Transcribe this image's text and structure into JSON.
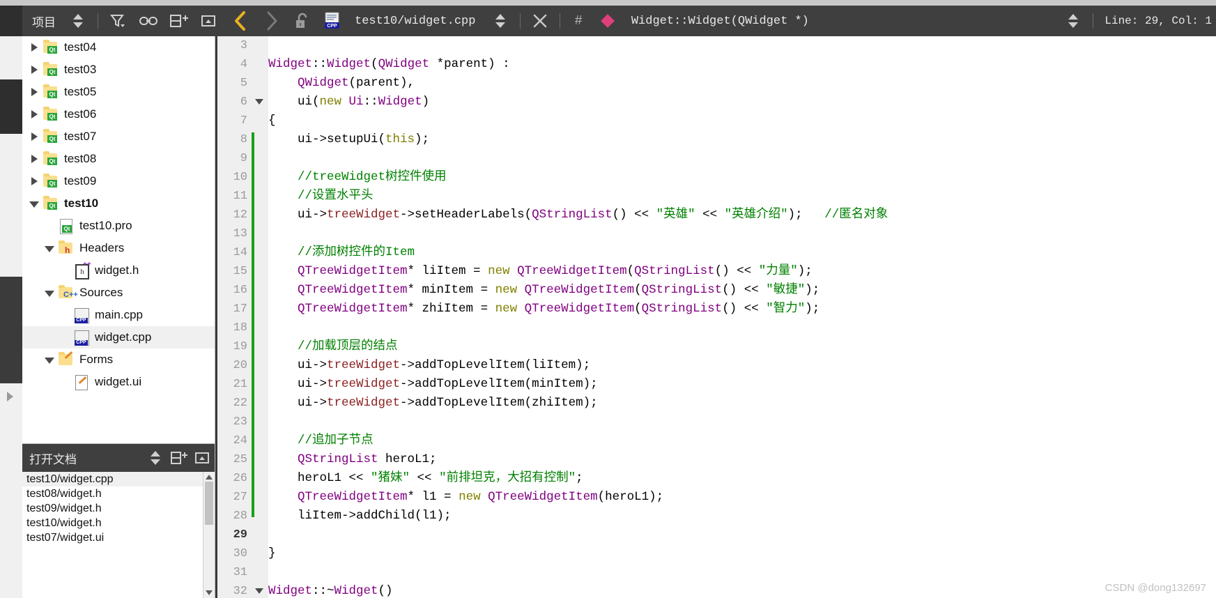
{
  "toolbar": {
    "project_label": "项目",
    "filter_icon": "filter-icon",
    "link_icon": "link-icon",
    "split_icon": "split-horizontal-icon",
    "close_split_icon": "close-split-icon",
    "back_icon": "navigate-back-icon",
    "forward_icon": "navigate-forward-icon",
    "lock_icon": "unlocked-padlock-icon",
    "file_icon": "cpp-file-icon",
    "file_path": "test10/widget.cpp",
    "updown_icon": "updown-arrows-icon",
    "close_icon": "close-x-icon",
    "hash_symbol": "#",
    "symbol_marker_icon": "diamond-marker-icon",
    "symbol_name": "Widget::Widget(QWidget *)",
    "line_col": "Line: 29, Col: 1"
  },
  "sidebar": {
    "tree_items": [
      {
        "label": "test04",
        "indent": 0,
        "twisty": "closed",
        "icon": "qt-folder-icon",
        "bold": false,
        "selected": false
      },
      {
        "label": "test03",
        "indent": 0,
        "twisty": "closed",
        "icon": "qt-folder-icon",
        "bold": false,
        "selected": false
      },
      {
        "label": "test05",
        "indent": 0,
        "twisty": "closed",
        "icon": "qt-folder-icon",
        "bold": false,
        "selected": false
      },
      {
        "label": "test06",
        "indent": 0,
        "twisty": "closed",
        "icon": "qt-folder-icon",
        "bold": false,
        "selected": false
      },
      {
        "label": "test07",
        "indent": 0,
        "twisty": "closed",
        "icon": "qt-folder-icon",
        "bold": false,
        "selected": false
      },
      {
        "label": "test08",
        "indent": 0,
        "twisty": "closed",
        "icon": "qt-folder-icon",
        "bold": false,
        "selected": false
      },
      {
        "label": "test09",
        "indent": 0,
        "twisty": "closed",
        "icon": "qt-folder-icon",
        "bold": false,
        "selected": false
      },
      {
        "label": "test10",
        "indent": 0,
        "twisty": "open",
        "icon": "qt-folder-icon",
        "bold": true,
        "selected": false
      },
      {
        "label": "test10.pro",
        "indent": 1,
        "twisty": "none",
        "icon": "qt-pro-file-icon",
        "bold": false,
        "selected": false
      },
      {
        "label": "Headers",
        "indent": 1,
        "twisty": "open",
        "icon": "h-folder-icon",
        "bold": false,
        "selected": false
      },
      {
        "label": "widget.h",
        "indent": 2,
        "twisty": "none",
        "icon": "hpp-file-icon",
        "bold": false,
        "selected": false
      },
      {
        "label": "Sources",
        "indent": 1,
        "twisty": "open",
        "icon": "cpp-folder-icon",
        "bold": false,
        "selected": false
      },
      {
        "label": "main.cpp",
        "indent": 2,
        "twisty": "none",
        "icon": "cpp-file-icon",
        "bold": false,
        "selected": false
      },
      {
        "label": "widget.cpp",
        "indent": 2,
        "twisty": "none",
        "icon": "cpp-file-icon",
        "bold": false,
        "selected": true
      },
      {
        "label": "Forms",
        "indent": 1,
        "twisty": "open",
        "icon": "forms-folder-icon",
        "bold": false,
        "selected": false
      },
      {
        "label": "widget.ui",
        "indent": 2,
        "twisty": "none",
        "icon": "ui-file-icon",
        "bold": false,
        "selected": false
      }
    ],
    "opendocs": {
      "title": "打开文档",
      "updown_icon": "updown-arrows-icon",
      "split_icon": "split-horizontal-icon",
      "close_icon": "close-split-icon",
      "files": [
        {
          "name": "test10/widget.cpp",
          "selected": true
        },
        {
          "name": "test08/widget.h",
          "selected": false
        },
        {
          "name": "test09/widget.h",
          "selected": false
        },
        {
          "name": "test10/widget.h",
          "selected": false
        },
        {
          "name": "test07/widget.ui",
          "selected": false
        }
      ]
    }
  },
  "editor": {
    "current_line": 29,
    "fold_lines": [
      6,
      32
    ],
    "lines": [
      {
        "n": 3,
        "tokens": []
      },
      {
        "n": 4,
        "tokens": [
          {
            "t": "Widget",
            "c": "c-type"
          },
          {
            "t": "::",
            "c": "c-plain"
          },
          {
            "t": "Widget",
            "c": "c-type"
          },
          {
            "t": "(",
            "c": "c-plain"
          },
          {
            "t": "QWidget",
            "c": "c-type"
          },
          {
            "t": " *parent) :",
            "c": "c-plain"
          }
        ]
      },
      {
        "n": 5,
        "tokens": [
          {
            "t": "    ",
            "c": "c-plain"
          },
          {
            "t": "QWidget",
            "c": "c-type"
          },
          {
            "t": "(parent),",
            "c": "c-plain"
          }
        ]
      },
      {
        "n": 6,
        "tokens": [
          {
            "t": "    ui(",
            "c": "c-plain"
          },
          {
            "t": "new",
            "c": "c-kw"
          },
          {
            "t": " ",
            "c": "c-plain"
          },
          {
            "t": "Ui",
            "c": "c-type"
          },
          {
            "t": "::",
            "c": "c-plain"
          },
          {
            "t": "Widget",
            "c": "c-type"
          },
          {
            "t": ")",
            "c": "c-plain"
          }
        ]
      },
      {
        "n": 7,
        "tokens": [
          {
            "t": "{",
            "c": "c-plain"
          }
        ]
      },
      {
        "n": 8,
        "tokens": [
          {
            "t": "    ui->setupUi(",
            "c": "c-plain"
          },
          {
            "t": "this",
            "c": "c-kw"
          },
          {
            "t": ");",
            "c": "c-plain"
          }
        ]
      },
      {
        "n": 9,
        "tokens": []
      },
      {
        "n": 10,
        "tokens": [
          {
            "t": "    //treeWidget树控件使用",
            "c": "c-comment"
          }
        ]
      },
      {
        "n": 11,
        "tokens": [
          {
            "t": "    //设置水平头",
            "c": "c-comment"
          }
        ]
      },
      {
        "n": 12,
        "tokens": [
          {
            "t": "    ui->",
            "c": "c-plain"
          },
          {
            "t": "treeWidget",
            "c": "c-member"
          },
          {
            "t": "->setHeaderLabels(",
            "c": "c-plain"
          },
          {
            "t": "QStringList",
            "c": "c-type"
          },
          {
            "t": "() << ",
            "c": "c-plain"
          },
          {
            "t": "\"英雄\"",
            "c": "c-str"
          },
          {
            "t": " << ",
            "c": "c-plain"
          },
          {
            "t": "\"英雄介绍\"",
            "c": "c-str"
          },
          {
            "t": ");   ",
            "c": "c-plain"
          },
          {
            "t": "//匿名对象",
            "c": "c-comment"
          }
        ]
      },
      {
        "n": 13,
        "tokens": []
      },
      {
        "n": 14,
        "tokens": [
          {
            "t": "    //添加树控件的Item",
            "c": "c-comment"
          }
        ]
      },
      {
        "n": 15,
        "tokens": [
          {
            "t": "    ",
            "c": "c-plain"
          },
          {
            "t": "QTreeWidgetItem",
            "c": "c-type"
          },
          {
            "t": "* liItem = ",
            "c": "c-plain"
          },
          {
            "t": "new",
            "c": "c-kw"
          },
          {
            "t": " ",
            "c": "c-plain"
          },
          {
            "t": "QTreeWidgetItem",
            "c": "c-type"
          },
          {
            "t": "(",
            "c": "c-plain"
          },
          {
            "t": "QStringList",
            "c": "c-type"
          },
          {
            "t": "() << ",
            "c": "c-plain"
          },
          {
            "t": "\"力量\"",
            "c": "c-str"
          },
          {
            "t": ");",
            "c": "c-plain"
          }
        ]
      },
      {
        "n": 16,
        "tokens": [
          {
            "t": "    ",
            "c": "c-plain"
          },
          {
            "t": "QTreeWidgetItem",
            "c": "c-type"
          },
          {
            "t": "* minItem = ",
            "c": "c-plain"
          },
          {
            "t": "new",
            "c": "c-kw"
          },
          {
            "t": " ",
            "c": "c-plain"
          },
          {
            "t": "QTreeWidgetItem",
            "c": "c-type"
          },
          {
            "t": "(",
            "c": "c-plain"
          },
          {
            "t": "QStringList",
            "c": "c-type"
          },
          {
            "t": "() << ",
            "c": "c-plain"
          },
          {
            "t": "\"敏捷\"",
            "c": "c-str"
          },
          {
            "t": ");",
            "c": "c-plain"
          }
        ]
      },
      {
        "n": 17,
        "tokens": [
          {
            "t": "    ",
            "c": "c-plain"
          },
          {
            "t": "QTreeWidgetItem",
            "c": "c-type"
          },
          {
            "t": "* zhiItem = ",
            "c": "c-plain"
          },
          {
            "t": "new",
            "c": "c-kw"
          },
          {
            "t": " ",
            "c": "c-plain"
          },
          {
            "t": "QTreeWidgetItem",
            "c": "c-type"
          },
          {
            "t": "(",
            "c": "c-plain"
          },
          {
            "t": "QStringList",
            "c": "c-type"
          },
          {
            "t": "() << ",
            "c": "c-plain"
          },
          {
            "t": "\"智力\"",
            "c": "c-str"
          },
          {
            "t": ");",
            "c": "c-plain"
          }
        ]
      },
      {
        "n": 18,
        "tokens": []
      },
      {
        "n": 19,
        "tokens": [
          {
            "t": "    //加载顶层的结点",
            "c": "c-comment"
          }
        ]
      },
      {
        "n": 20,
        "tokens": [
          {
            "t": "    ui->",
            "c": "c-plain"
          },
          {
            "t": "treeWidget",
            "c": "c-member"
          },
          {
            "t": "->addTopLevelItem(liItem);",
            "c": "c-plain"
          }
        ]
      },
      {
        "n": 21,
        "tokens": [
          {
            "t": "    ui->",
            "c": "c-plain"
          },
          {
            "t": "treeWidget",
            "c": "c-member"
          },
          {
            "t": "->addTopLevelItem(minItem);",
            "c": "c-plain"
          }
        ]
      },
      {
        "n": 22,
        "tokens": [
          {
            "t": "    ui->",
            "c": "c-plain"
          },
          {
            "t": "treeWidget",
            "c": "c-member"
          },
          {
            "t": "->addTopLevelItem(zhiItem);",
            "c": "c-plain"
          }
        ]
      },
      {
        "n": 23,
        "tokens": []
      },
      {
        "n": 24,
        "tokens": [
          {
            "t": "    //追加子节点",
            "c": "c-comment"
          }
        ]
      },
      {
        "n": 25,
        "tokens": [
          {
            "t": "    ",
            "c": "c-plain"
          },
          {
            "t": "QStringList",
            "c": "c-type"
          },
          {
            "t": " heroL1;",
            "c": "c-plain"
          }
        ]
      },
      {
        "n": 26,
        "tokens": [
          {
            "t": "    heroL1 << ",
            "c": "c-plain"
          },
          {
            "t": "\"猪妹\"",
            "c": "c-str"
          },
          {
            "t": " << ",
            "c": "c-plain"
          },
          {
            "t": "\"前排坦克，大招有控制\"",
            "c": "c-str"
          },
          {
            "t": ";",
            "c": "c-plain"
          }
        ]
      },
      {
        "n": 27,
        "tokens": [
          {
            "t": "    ",
            "c": "c-plain"
          },
          {
            "t": "QTreeWidgetItem",
            "c": "c-type"
          },
          {
            "t": "* l1 = ",
            "c": "c-plain"
          },
          {
            "t": "new",
            "c": "c-kw"
          },
          {
            "t": " ",
            "c": "c-plain"
          },
          {
            "t": "QTreeWidgetItem",
            "c": "c-type"
          },
          {
            "t": "(heroL1);",
            "c": "c-plain"
          }
        ]
      },
      {
        "n": 28,
        "tokens": [
          {
            "t": "    liItem->addChild(l1);",
            "c": "c-plain"
          }
        ]
      },
      {
        "n": 29,
        "tokens": []
      },
      {
        "n": 30,
        "tokens": [
          {
            "t": "}",
            "c": "c-plain"
          }
        ]
      },
      {
        "n": 31,
        "tokens": []
      },
      {
        "n": 32,
        "tokens": [
          {
            "t": "Widget",
            "c": "c-type"
          },
          {
            "t": "::~",
            "c": "c-plain"
          },
          {
            "t": "Widget",
            "c": "c-type"
          },
          {
            "t": "()",
            "c": "c-plain"
          }
        ]
      }
    ]
  },
  "watermark": "CSDN @dong132697",
  "colors": {
    "toolbar_bg": "#3f3f3f",
    "editor_bg": "#ffffff",
    "gutter_bg": "#efefef",
    "change_bar": "#18a018",
    "type_color": "#800080",
    "keyword_color": "#808000",
    "string_color": "#008000",
    "comment_color": "#008000",
    "member_color": "#8b2020",
    "selection_bg": "#f0f0f0",
    "back_arrow": "#e8b020",
    "symbol_marker": "#e0407a"
  }
}
